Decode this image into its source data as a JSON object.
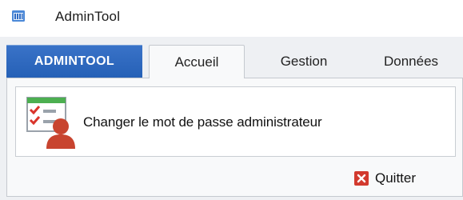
{
  "window": {
    "title": "AdminTool",
    "icon": "app-grid-icon"
  },
  "ribbon": {
    "app_tab_label": "ADMINTOOL",
    "tabs": [
      {
        "label": "Accueil",
        "active": true
      },
      {
        "label": "Gestion",
        "active": false
      },
      {
        "label": "Données",
        "active": false
      }
    ]
  },
  "main": {
    "change_password_label": "Changer le mot de passe administrateur",
    "change_password_icon": "checklist-user-icon",
    "quit_label": "Quitter",
    "quit_icon": "close-icon"
  },
  "colors": {
    "app_tab": "#2f6bc3",
    "quit_red": "#d23a2e",
    "user_red": "#c8442f",
    "check_red": "#d9342b",
    "ribbon_bg": "#eef0f3"
  }
}
